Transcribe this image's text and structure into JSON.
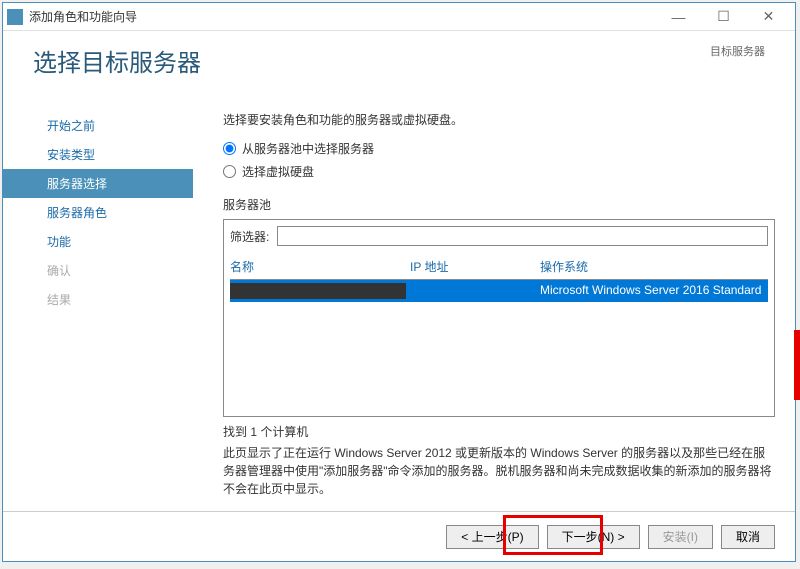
{
  "window": {
    "title": "添加角色和功能向导"
  },
  "header": {
    "page_title": "选择目标服务器",
    "target_label": "目标服务器"
  },
  "sidebar": {
    "items": [
      {
        "label": "开始之前",
        "state": "normal"
      },
      {
        "label": "安装类型",
        "state": "normal"
      },
      {
        "label": "服务器选择",
        "state": "active"
      },
      {
        "label": "服务器角色",
        "state": "normal"
      },
      {
        "label": "功能",
        "state": "normal"
      },
      {
        "label": "确认",
        "state": "disabled"
      },
      {
        "label": "结果",
        "state": "disabled"
      }
    ]
  },
  "main": {
    "instruction": "选择要安装角色和功能的服务器或虚拟硬盘。",
    "radio": {
      "from_pool": "从服务器池中选择服务器",
      "select_vhd": "选择虚拟硬盘",
      "selected": "from_pool"
    },
    "pool_label": "服务器池",
    "filter_label": "筛选器:",
    "filter_value": "",
    "columns": {
      "name": "名称",
      "ip": "IP 地址",
      "os": "操作系统"
    },
    "rows": [
      {
        "name": "",
        "ip": "",
        "os": "Microsoft Windows Server 2016 Standard",
        "selected": true
      }
    ],
    "found_label": "找到 1 个计算机",
    "description": "此页显示了正在运行 Windows Server 2012 或更新版本的 Windows Server 的服务器以及那些已经在服务器管理器中使用\"添加服务器\"命令添加的服务器。脱机服务器和尚未完成数据收集的新添加的服务器将不会在此页中显示。"
  },
  "footer": {
    "prev": "< 上一步(P)",
    "next": "下一步(N) >",
    "install": "安装(I)",
    "cancel": "取消"
  }
}
